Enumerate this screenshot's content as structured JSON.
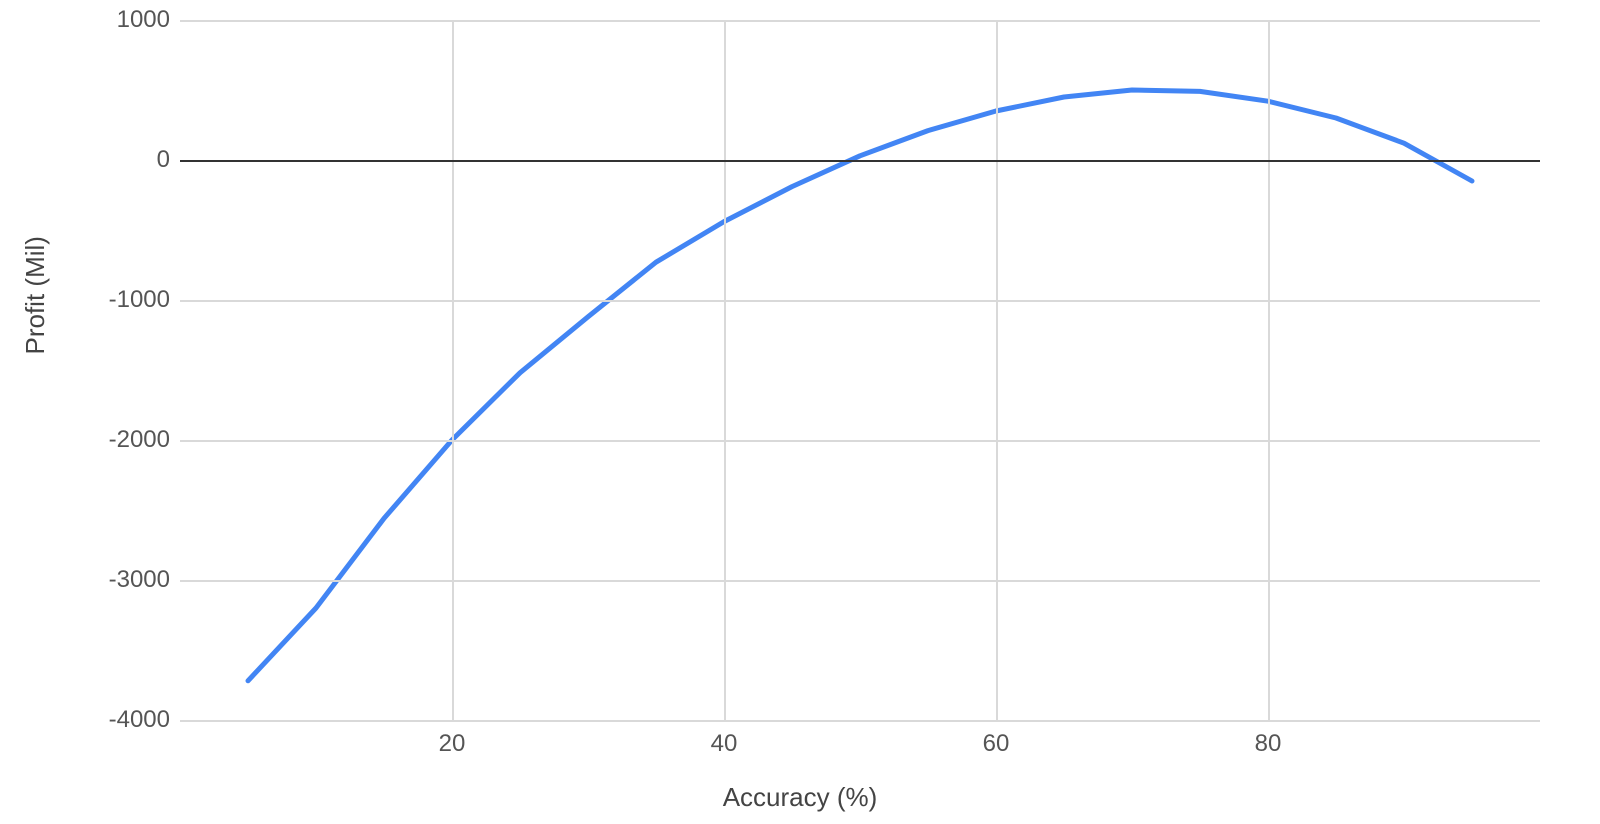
{
  "chart_data": {
    "type": "line",
    "xlabel": "Accuracy (%)",
    "ylabel": "Profit (Mil)",
    "xlim": [
      0,
      100
    ],
    "ylim": [
      -4000,
      1000
    ],
    "x_ticks": [
      20,
      40,
      60,
      80
    ],
    "y_ticks": [
      -4000,
      -3000,
      -2000,
      -1000,
      0,
      1000
    ],
    "grid": true,
    "series": [
      {
        "name": "Profit",
        "color": "#4285f4",
        "x": [
          5,
          10,
          15,
          20,
          25,
          30,
          35,
          40,
          45,
          50,
          55,
          60,
          65,
          70,
          75,
          80,
          85,
          90,
          95
        ],
        "values": [
          -3720,
          -3200,
          -2560,
          -2000,
          -1520,
          -1120,
          -730,
          -440,
          -190,
          30,
          210,
          350,
          450,
          500,
          490,
          420,
          300,
          120,
          -150
        ]
      }
    ]
  }
}
